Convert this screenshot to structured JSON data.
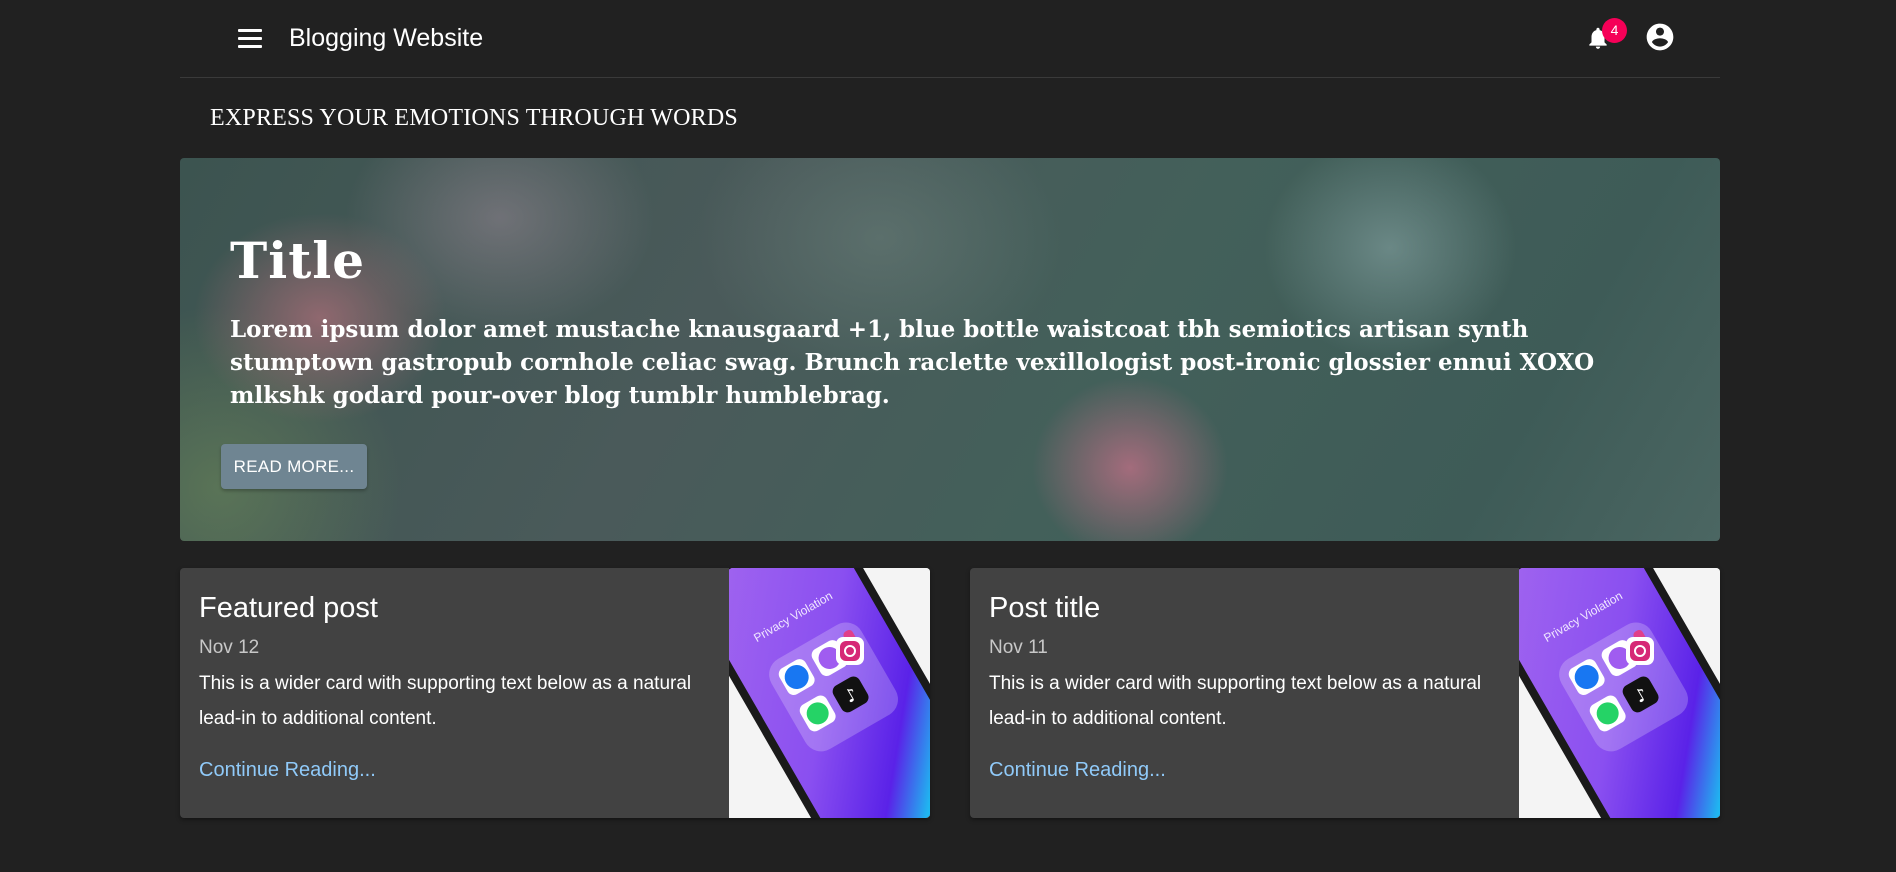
{
  "header": {
    "site_title": "Blogging Website",
    "notification_count": "4",
    "icons": [
      "menu-icon",
      "bell-icon",
      "account-circle-icon"
    ]
  },
  "tagline": "EXPRESS YOUR EMOTIONS THROUGH WORDS",
  "hero": {
    "title": "Title",
    "text": "Lorem ipsum dolor amet mustache knausgaard +1, blue bottle waistcoat tbh semiotics artisan synth stumptown gastropub cornhole celiac swag. Brunch raclette vexillologist post-ironic glossier ennui XOXO mlkshk godard pour-over blog tumblr humblebrag.",
    "button_label": "READ MORE..."
  },
  "cards": [
    {
      "title": "Featured post",
      "date": "Nov 12",
      "text": "This is a wider card with supporting text below as a natural lead-in to additional content.",
      "link_label": "Continue Reading...",
      "image_caption": "Privacy Violation"
    },
    {
      "title": "Post title",
      "date": "Nov 11",
      "text": "This is a wider card with supporting text below as a natural lead-in to additional content.",
      "link_label": "Continue Reading...",
      "image_caption": "Privacy Violation"
    }
  ],
  "colors": {
    "background": "#212121",
    "card": "#424242",
    "badge": "#f50057",
    "link": "#90caf9",
    "button": "#6f8592"
  }
}
